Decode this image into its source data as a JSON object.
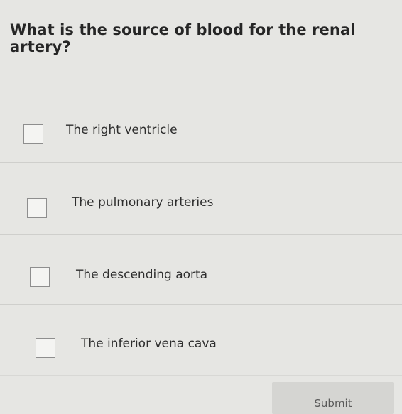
{
  "question": "What is the source of blood for the renal artery?",
  "options": [
    {
      "label": "The right ventricle",
      "checked": false
    },
    {
      "label": "The pulmonary arteries",
      "checked": false
    },
    {
      "label": "The descending aorta",
      "checked": false
    },
    {
      "label": "The inferior vena cava",
      "checked": false
    }
  ],
  "submit_label": "Submit"
}
